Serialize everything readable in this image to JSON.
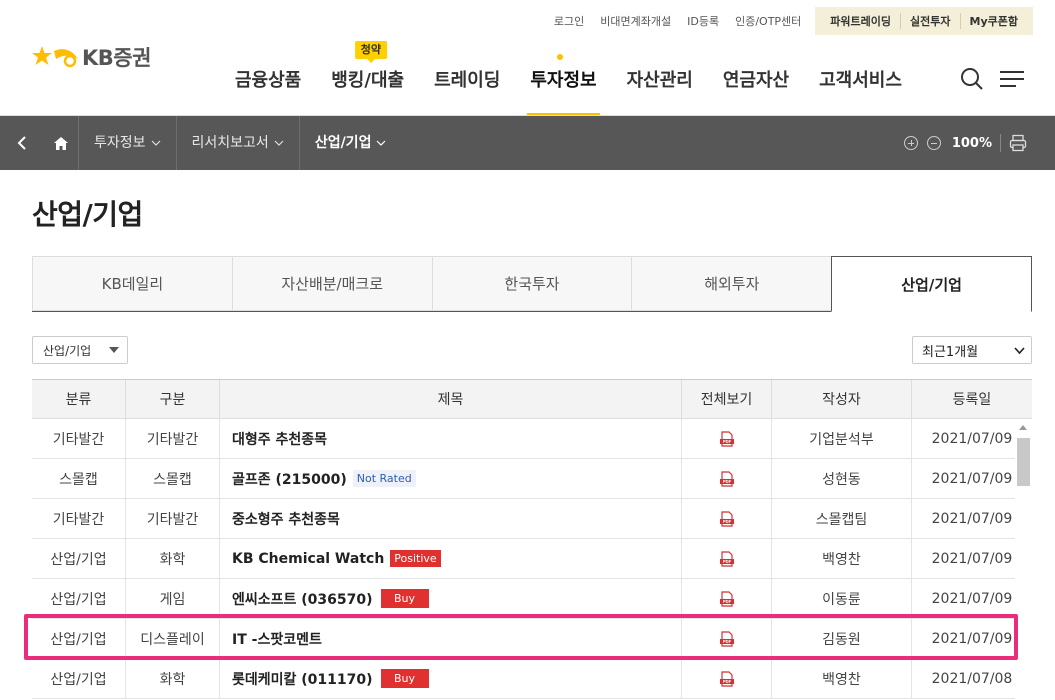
{
  "util": {
    "links": [
      "로그인",
      "비대면계좌개설",
      "ID등록",
      "인증/OTP센터"
    ],
    "box": [
      "파워트레이딩",
      "실전투자",
      "My쿠폰함"
    ]
  },
  "logo": {
    "text": "KB증권"
  },
  "gnb": {
    "items": [
      {
        "label": "금융상품"
      },
      {
        "label": "뱅킹/대출",
        "badge": "청약"
      },
      {
        "label": "트레이딩"
      },
      {
        "label": "투자정보",
        "active": true
      },
      {
        "label": "자산관리"
      },
      {
        "label": "연금자산"
      },
      {
        "label": "고객서비스"
      }
    ],
    "icons": [
      "search-icon",
      "menu-icon"
    ]
  },
  "breadcrumb": {
    "items": [
      "투자정보",
      "리서치보고서",
      "산업/기업"
    ],
    "zoom": "100%"
  },
  "page": {
    "title": "산업/기업"
  },
  "tabs": [
    "KB데일리",
    "자산배분/매크로",
    "한국투자",
    "해외투자",
    "산업/기업"
  ],
  "active_tab": 4,
  "filters": {
    "category": "산업/기업",
    "period": "최근1개월"
  },
  "table": {
    "headers": [
      "분류",
      "구분",
      "제목",
      "전체보기",
      "작성자",
      "등록일"
    ],
    "rows": [
      {
        "cat": "기타발간",
        "sub": "기타발간",
        "title": "대형주 추천종목",
        "tag": "",
        "tag_type": "",
        "author": "기업분석부",
        "date": "2021/07/09"
      },
      {
        "cat": "스몰캡",
        "sub": "스몰캡",
        "title": "골프존 (215000)",
        "tag": "Not Rated",
        "tag_type": "nr",
        "author": "성현동",
        "date": "2021/07/09"
      },
      {
        "cat": "기타발간",
        "sub": "기타발간",
        "title": "중소형주 추천종목",
        "tag": "",
        "tag_type": "",
        "author": "스몰캡팀",
        "date": "2021/07/09"
      },
      {
        "cat": "산업/기업",
        "sub": "화학",
        "title": "KB Chemical Watch",
        "tag": "Positive",
        "tag_type": "pos",
        "author": "백영찬",
        "date": "2021/07/09"
      },
      {
        "cat": "산업/기업",
        "sub": "게임",
        "title": "엔씨소프트 (036570)",
        "tag": "Buy",
        "tag_type": "buy",
        "author": "이동륜",
        "date": "2021/07/09"
      },
      {
        "cat": "산업/기업",
        "sub": "디스플레이",
        "title": "IT -스팟코멘트",
        "tag": "",
        "tag_type": "",
        "author": "김동원",
        "date": "2021/07/09"
      },
      {
        "cat": "산업/기업",
        "sub": "화학",
        "title": "롯데케미칼 (011170)",
        "tag": "Buy",
        "tag_type": "buy",
        "author": "백영찬",
        "date": "2021/07/08"
      }
    ]
  },
  "colors": {
    "accent": "#ffc000",
    "dark_bar": "#575757",
    "highlight": "#ea2d7b",
    "rating_red": "#e0302f"
  }
}
